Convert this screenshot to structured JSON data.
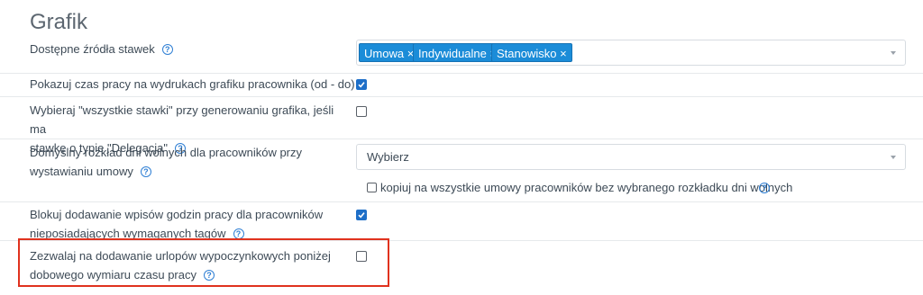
{
  "section_title": "Grafik",
  "help_glyph": "?",
  "settings": {
    "rate_sources": {
      "label": "Dostępne źródła stawek",
      "tags": [
        "Umowa",
        "Indywidualne",
        "Stanowisko"
      ],
      "remove_glyph": "×"
    },
    "show_work_time": {
      "label": "Pokazuj czas pracy na wydrukach grafiku pracownika (od - do)",
      "checked": true
    },
    "choose_all_rates": {
      "label_line1": "Wybieraj \"wszystkie stawki\" przy generowaniu grafika, jeśli ma",
      "label_line2": "stawkę o typie \"Delegacja\"",
      "checked": false
    },
    "default_days_off": {
      "label_line1": "Domyślny rozkład dni wolnych dla pracowników przy",
      "label_line2": "wystawianiu umowy",
      "select_value": "Wybierz",
      "copy_label": "kopiuj na wszystkie umowy pracowników bez wybranego rozkładku dni wolnych",
      "copy_checked": false
    },
    "block_entries": {
      "label_line1": "Blokuj dodawanie wpisów godzin pracy dla pracowników",
      "label_line2": "nieposiadających wymaganych tagów",
      "checked": true
    },
    "allow_leave": {
      "label_line1": "Zezwalaj na dodawanie urlopów wypoczynkowych poniżej",
      "label_line2": "dobowego wymiaru czasu pracy",
      "checked": false
    }
  },
  "colors": {
    "accent": "#1b8cd8",
    "highlight": "#e0321e",
    "checkbox": "#1e6fc8"
  }
}
